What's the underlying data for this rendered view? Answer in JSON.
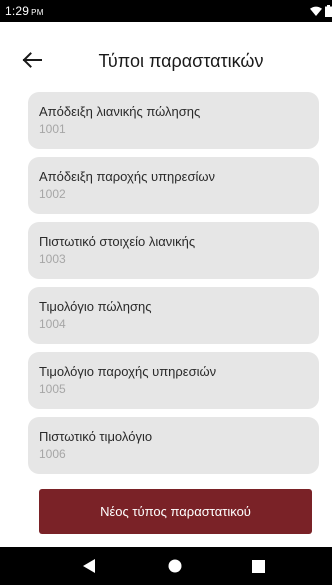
{
  "status_bar": {
    "time": "1:29",
    "ampm": "PM"
  },
  "app_bar": {
    "title": "Τύποι παραστατικών"
  },
  "document_types": [
    {
      "name": "Απόδειξη λιανικής πώλησης",
      "code": "1001"
    },
    {
      "name": "Απόδειξη παροχής υπηρεσίων",
      "code": "1002"
    },
    {
      "name": "Πιστωτικό στοιχείο λιανικής",
      "code": "1003"
    },
    {
      "name": "Τιμολόγιο πώλησης",
      "code": "1004"
    },
    {
      "name": "Τιμολόγιο παροχής υπηρεσιών",
      "code": "1005"
    },
    {
      "name": "Πιστωτικό τιμολόγιο",
      "code": "1006"
    }
  ],
  "actions": {
    "new_type_label": "Νέος τύπος παραστατικού"
  },
  "icons": {
    "back": "arrow-left-icon",
    "wifi": "wifi-icon",
    "battery": "battery-icon",
    "nav_back": "triangle-back-icon",
    "nav_home": "circle-home-icon",
    "nav_recents": "square-recents-icon"
  },
  "colors": {
    "primary_button": "#7a2227",
    "card_background": "#e6e6e6",
    "code_text": "#a6a6a6",
    "system_bars": "#000000"
  }
}
